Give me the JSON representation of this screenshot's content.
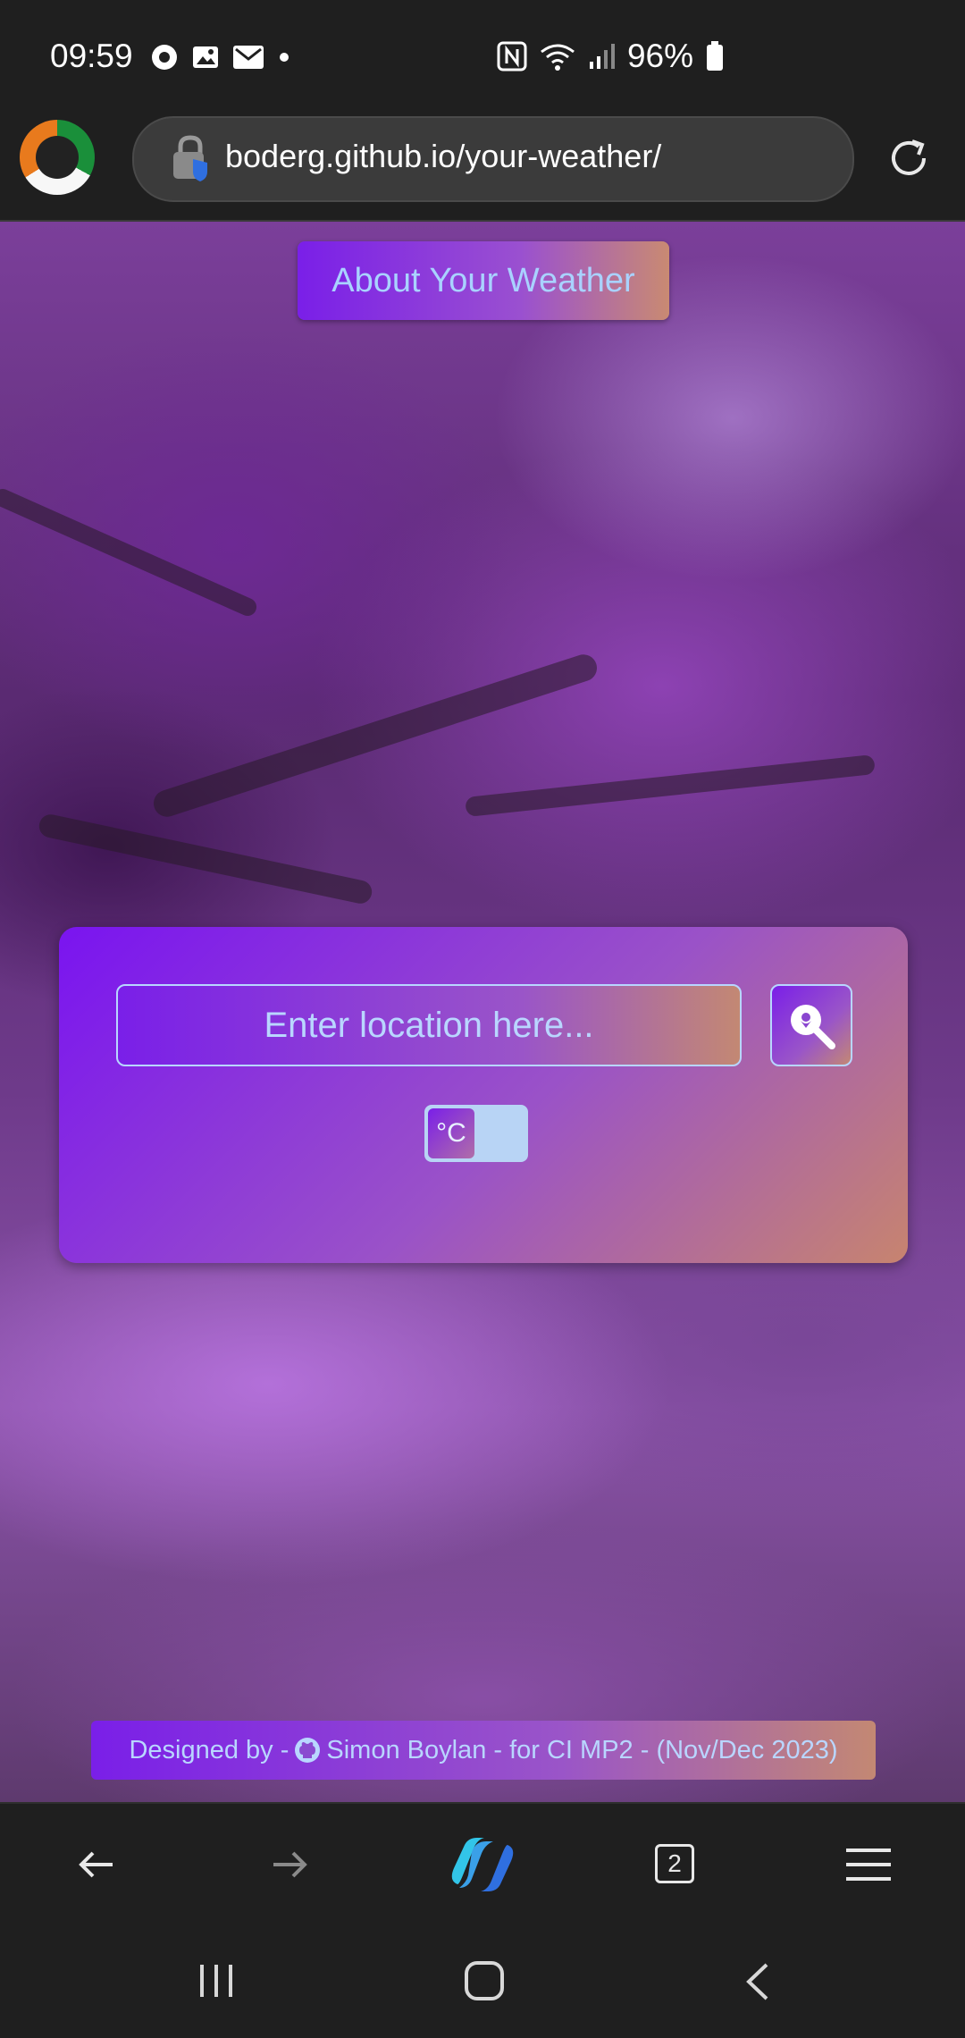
{
  "status_bar": {
    "time": "09:59",
    "battery": "96%",
    "left_icons": [
      "record-icon",
      "image-icon",
      "mail-icon",
      "dot-icon"
    ],
    "right_icons": [
      "nfc-icon",
      "wifi-icon",
      "signal-icon",
      "battery-icon"
    ]
  },
  "browser": {
    "url": "boderg.github.io/your-weather/",
    "tabs_count": "2"
  },
  "page": {
    "about_button": "About Your Weather",
    "search": {
      "placeholder": "Enter location here..."
    },
    "unit_toggle": {
      "label": "°C"
    },
    "footer": {
      "prefix": "Designed by -",
      "suffix": "Simon Boylan - for CI MP2 - (Nov/Dec 2023)"
    }
  },
  "colors": {
    "accent_start": "#7a1fe8",
    "accent_end": "#c38873",
    "text_light_blue": "#b9d6ff"
  }
}
